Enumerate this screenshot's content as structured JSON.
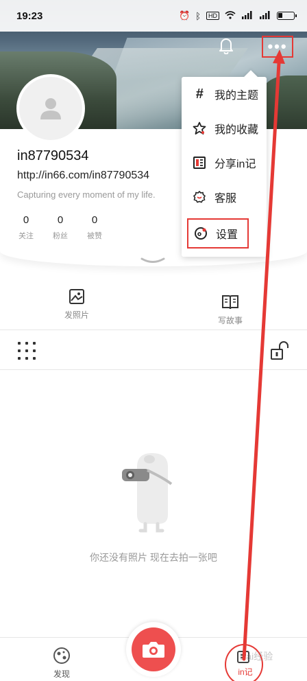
{
  "status_bar": {
    "time": "19:23",
    "hd_badge": "HD"
  },
  "header": {
    "bell_icon": "bell-icon",
    "more_icon": "more-dots-icon",
    "more_label": "•••"
  },
  "profile": {
    "username": "in87790534",
    "homepage": "http://in66.com/in87790534",
    "bio": "Capturing every moment of my life.",
    "stats": [
      {
        "value": "0",
        "label": "关注"
      },
      {
        "value": "0",
        "label": "粉丝"
      },
      {
        "value": "0",
        "label": "被赞"
      }
    ]
  },
  "menu": {
    "items": [
      {
        "label": "我的主题",
        "icon": "hashtag-icon"
      },
      {
        "label": "我的收藏",
        "icon": "star-icon"
      },
      {
        "label": "分享in记",
        "icon": "share-icon"
      },
      {
        "label": "客服",
        "icon": "support-icon"
      },
      {
        "label": "设置",
        "icon": "settings-icon"
      }
    ]
  },
  "actions": {
    "photo_label": "发照片",
    "story_label": "写故事"
  },
  "empty_state": {
    "text": "你还没有照片 现在去拍一张吧"
  },
  "bottom_nav": {
    "discover_label": "发现",
    "inji_label": "in记"
  },
  "watermark": "Bai经验",
  "colors": {
    "accent": "#ee4f4f",
    "annotation": "#e53935"
  }
}
